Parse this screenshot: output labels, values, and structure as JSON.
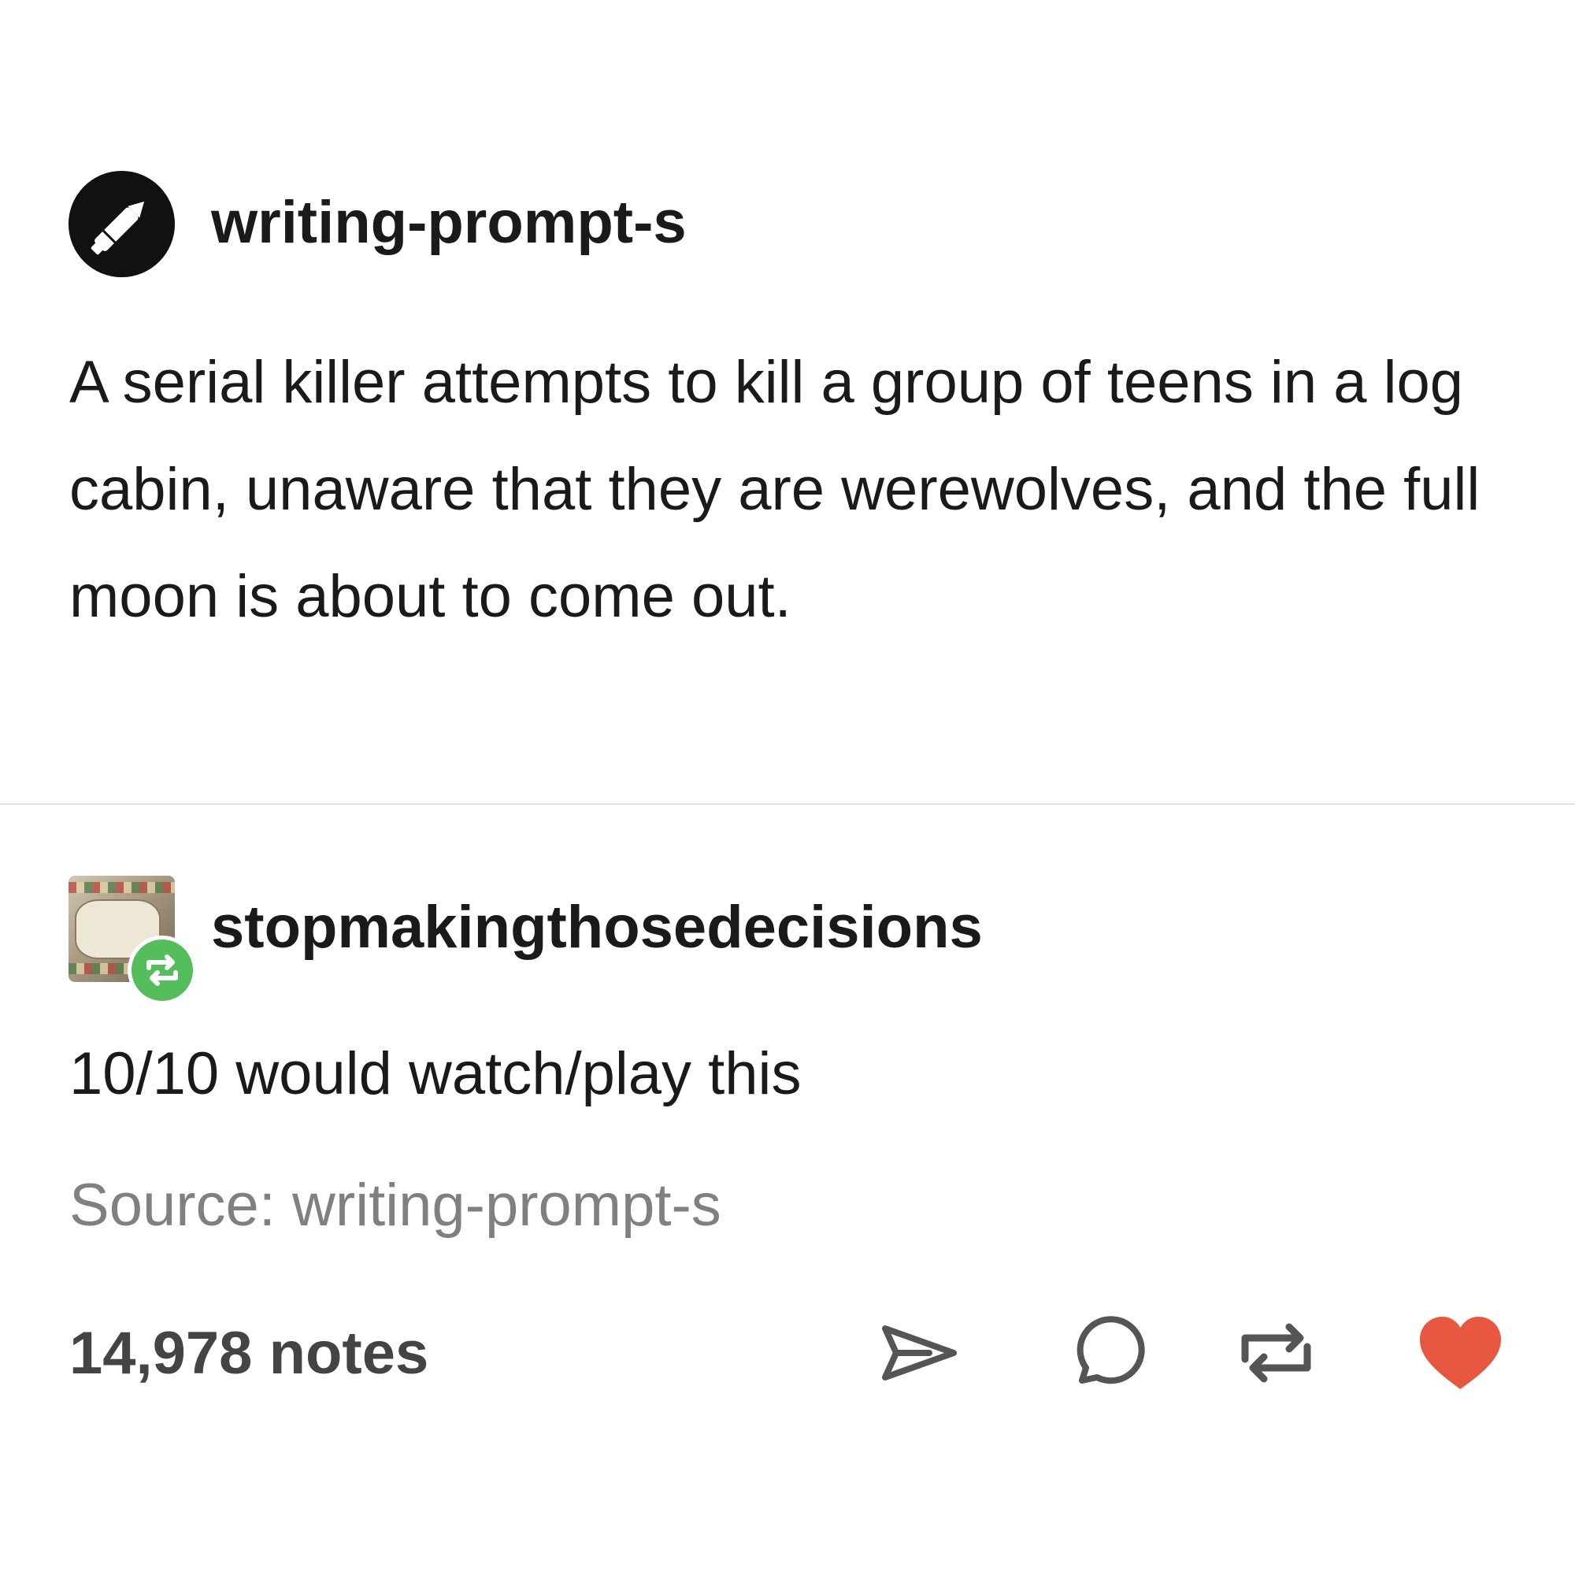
{
  "original_post": {
    "username": "writing-prompt-s",
    "avatar_icon": "pen-icon",
    "body": "A serial killer attempts to kill a group of teens in a log cabin, unaware that they are werewolves, and the full moon is about to come out."
  },
  "reblog": {
    "username": "stopmakingthosedecisions",
    "avatar_icon": "avatar-image",
    "badge_icon": "reblog-icon",
    "body": "10/10 would watch/play this",
    "source": "Source: writing-prompt-s"
  },
  "footer": {
    "notes": "14,978 notes",
    "actions": [
      "share-icon",
      "reply-icon",
      "reblog-icon",
      "heart-icon"
    ]
  },
  "colors": {
    "reblog_green": "#54be5d",
    "like_red": "#e8573f",
    "icon_gray": "#555555",
    "text": "#1a1a1a",
    "muted_text": "#808080"
  }
}
